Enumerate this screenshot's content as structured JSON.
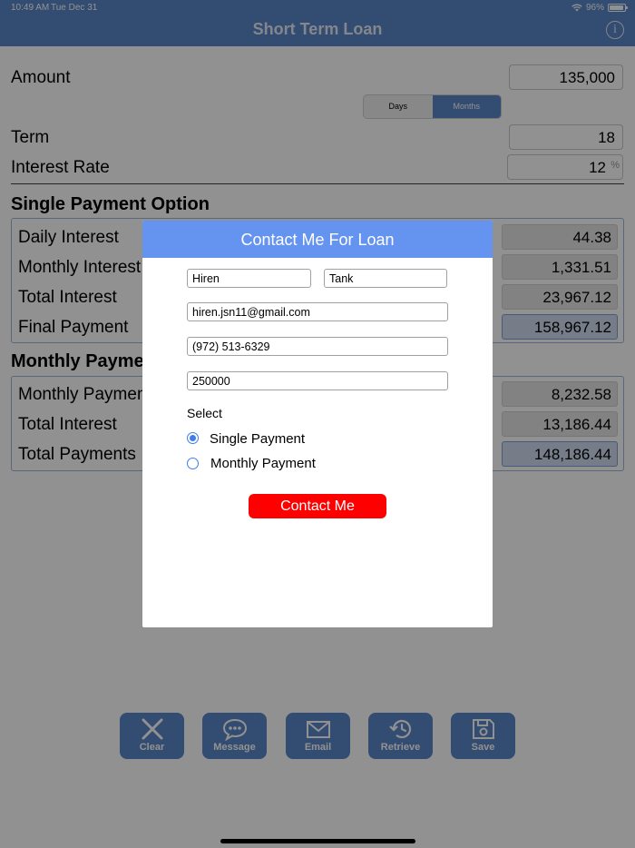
{
  "status": {
    "time": "10:49 AM",
    "date": "Tue Dec 31",
    "battery": "96%",
    "battery_level": 0.96
  },
  "nav": {
    "title": "Short Term Loan",
    "info_icon": "info-icon"
  },
  "form": {
    "amount_label": "Amount",
    "amount_value": "135,000",
    "segment": [
      {
        "label": "Days",
        "selected": false
      },
      {
        "label": "Months",
        "selected": true
      }
    ],
    "term_label": "Term",
    "term_value": "18",
    "rate_label": "Interest Rate",
    "rate_value": "12",
    "rate_unit": "%"
  },
  "single": {
    "title": "Single Payment Option",
    "rows": [
      {
        "label": "Daily Interest",
        "value": "44.38"
      },
      {
        "label": "Monthly Interest",
        "value": "1,331.51"
      },
      {
        "label": "Total Interest",
        "value": "23,967.12"
      },
      {
        "label": "Final Payment",
        "value": "158,967.12"
      }
    ]
  },
  "monthly": {
    "title": "Monthly Payment",
    "rows": [
      {
        "label": "Monthly Payment",
        "value": "8,232.58"
      },
      {
        "label": "Total Interest",
        "value": "13,186.44"
      },
      {
        "label": "Total Payments",
        "value": "148,186.44"
      }
    ]
  },
  "toolbar": [
    {
      "label": "Clear",
      "icon": "close-icon"
    },
    {
      "label": "Message",
      "icon": "message-icon"
    },
    {
      "label": "Email",
      "icon": "envelope-icon"
    },
    {
      "label": "Retrieve",
      "icon": "history-icon"
    },
    {
      "label": "Save",
      "icon": "floppy-disk-icon"
    }
  ],
  "modal": {
    "title": "Contact Me For Loan",
    "first_name": "Hiren",
    "last_name": "Tank",
    "email": "hiren.jsn11@gmail.com",
    "phone": "(972) 513-6329",
    "amount": "250000",
    "select_label": "Select",
    "options": [
      {
        "label": "Single Payment",
        "checked": true
      },
      {
        "label": "Monthly Payment",
        "checked": false
      }
    ],
    "button": "Contact Me"
  },
  "colors": {
    "nav": "#5b86c8",
    "modal_header": "#6594f0",
    "contact_button": "#ff0000",
    "radio": "#3f7ee8"
  }
}
